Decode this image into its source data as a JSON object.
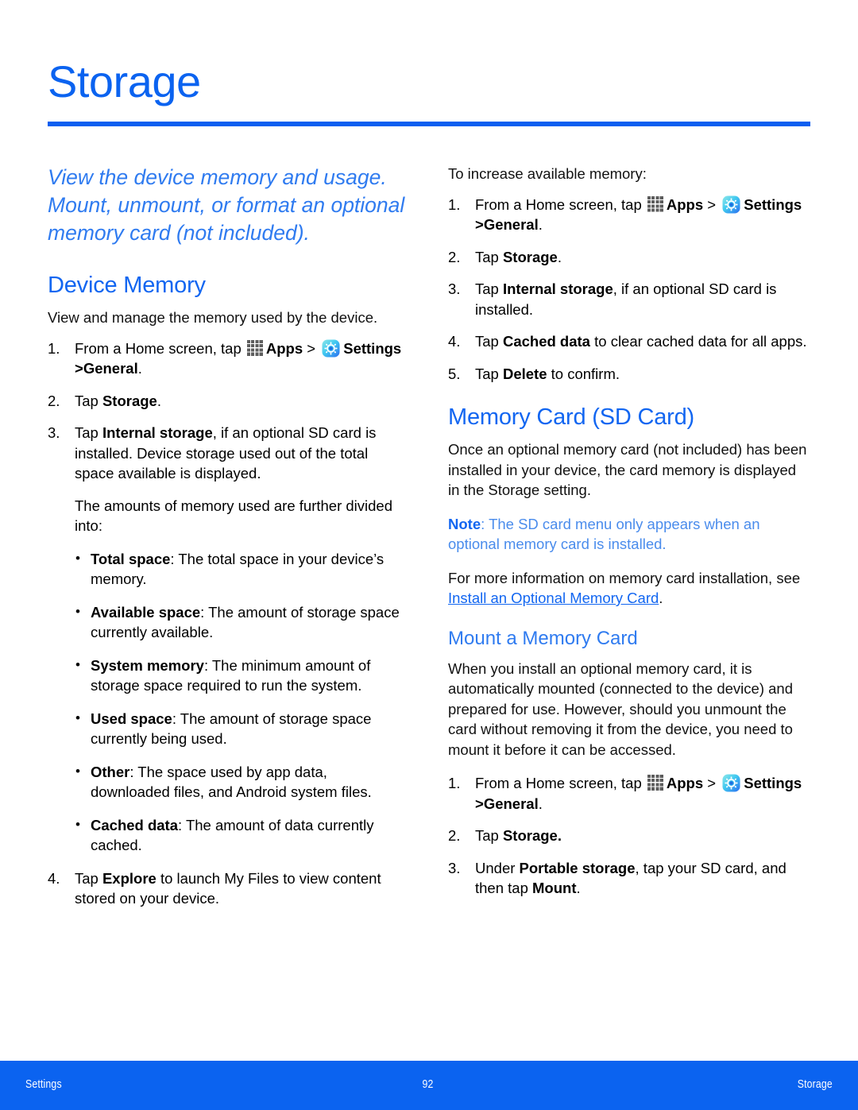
{
  "document": {
    "title": "Storage",
    "accent_color": "#0b63f0",
    "heading_color": "#1266f1",
    "note_color": "#4a8cec"
  },
  "intro": "View the device memory and usage. Mount, unmount, or format an optional memory card (not included).",
  "icons": {
    "apps": "apps-grid-icon",
    "settings": "settings-gear-icon"
  },
  "left_column": {
    "section_heading": "Device Memory",
    "lead": "View and manage the memory used by the device.",
    "steps": {
      "s1_pre": "From a Home screen, tap",
      "s1_apps": "Apps",
      "s1_gt1": ">",
      "s1_settings": "Settings",
      "s1_tail_gt": ">",
      "s1_general": "General",
      "s1_period": ".",
      "s2_pre": "Tap",
      "s2_bold": "Storage",
      "s2_post": ".",
      "s3_pre": "Tap",
      "s3_bold": "Internal storage",
      "s3_post": ", if an optional SD card is installed. Device storage used out of the total space available is displayed.",
      "s3_para": "The amounts of memory used are further divided into:",
      "s4_pre": "Tap",
      "s4_bold": "Explore",
      "s4_post": " to launch My Files to view content stored on your device."
    },
    "bullets": [
      {
        "term": "Total space",
        "desc": ": The total space in your device’s memory."
      },
      {
        "term": "Available space",
        "desc": ": The amount of storage space currently available."
      },
      {
        "term": "System memory",
        "desc": ": The minimum amount of storage space required to run the system."
      },
      {
        "term": "Used space",
        "desc": ": The amount of storage space currently being used."
      },
      {
        "term": "Other",
        "desc": ": The space used by app data, downloaded files, and Android system files."
      },
      {
        "term": "Cached data",
        "desc": ": The amount of data currently cached."
      }
    ]
  },
  "right_column": {
    "increase_lead": "To increase available memory:",
    "increase_steps": {
      "s1_pre": "From a Home screen, tap",
      "s1_apps": "Apps",
      "s1_gt1": ">",
      "s1_settings": "Settings",
      "s1_tail_gt": ">",
      "s1_general": "General",
      "s1_period": ".",
      "s2_pre": "Tap",
      "s2_bold": "Storage",
      "s2_post": ".",
      "s3_pre": "Tap",
      "s3_bold": "Internal storage",
      "s3_post": ", if an optional SD card is installed.",
      "s4_pre": "Tap",
      "s4_bold": "Cached data",
      "s4_post": " to clear cached data for all apps.",
      "s5_pre": "Tap",
      "s5_bold": "Delete",
      "s5_post": " to confirm."
    },
    "memory_card_heading": "Memory Card (SD Card)",
    "memory_card_body": "Once an optional memory card (not included) has been installed in your device, the card memory is displayed in the Storage setting.",
    "note_label": "Note",
    "note_text": ": The SD card menu only appears when an optional memory card is installed.",
    "more_info_pre": "For more information on memory card installation, see ",
    "more_info_link": "Install an Optional Memory Card",
    "more_info_post": ".",
    "mount_heading": "Mount a Memory Card",
    "mount_body": "When you install an optional memory card, it is automatically mounted (connected to the device) and prepared for use. However, should you unmount the card without removing it from the device, you need to mount it before it can be accessed.",
    "mount_steps": {
      "s1_pre": "From a Home screen, tap",
      "s1_apps": "Apps",
      "s1_gt1": ">",
      "s1_settings": "Settings",
      "s1_tail_gt": ">",
      "s1_general": "General",
      "s1_period": ".",
      "s2_pre": "Tap",
      "s2_bold": "Storage.",
      "s3_pre": "Under",
      "s3_bold": "Portable storage",
      "s3_mid": ", tap your SD card, and then tap ",
      "s3_bold2": "Mount",
      "s3_post": "."
    }
  },
  "footer": {
    "left": "Settings",
    "page_number": "92",
    "right": "Storage"
  }
}
